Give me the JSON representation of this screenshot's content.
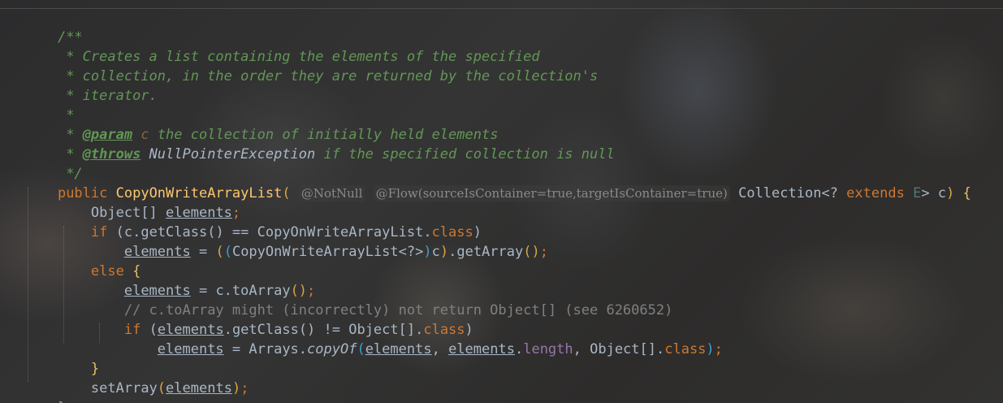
{
  "editor": {
    "code": {
      "javadoc_open": "/**",
      "doc_line_1": " * Creates a list containing the elements of the specified",
      "doc_line_2": " * collection, in the order they are returned by the collection's",
      "doc_line_3": " * iterator.",
      "doc_line_4": " *",
      "param_prefix": " * ",
      "param_tag": "@param",
      "param_name": " c",
      "param_desc": " the collection of initially held elements",
      "throws_prefix": " * ",
      "throws_tag": "@throws",
      "throws_ref": " NullPointerException",
      "throws_desc": " if the specified collection is null",
      "javadoc_close": " */",
      "sig_public": "public",
      "sig_name": "CopyOnWriteArrayList",
      "sig_paren_open": "(",
      "hint_notnull": "@NotNull",
      "hint_flow": "@Flow(sourceIsContainer=true,targetIsContainer=true)",
      "sig_type": "Collection<? ",
      "sig_extends": "extends",
      "sig_generic": "E",
      "sig_param": "> c",
      "sig_paren_close": ")",
      "sig_brace_open": "{",
      "decl_type": "Object[] ",
      "decl_var": "elements",
      "decl_semi": ";",
      "if1_kw": "if",
      "if1_cond_start": " (c.getClass() == CopyOnWriteArrayList.",
      "if1_class_kw": "class",
      "if1_close": ")",
      "assign1_var": "elements",
      "assign1_mid": " = ",
      "assign1_paren_a": "(",
      "assign1_paren_b": "(",
      "assign1_cast": "CopyOnWriteArrayList<?>",
      "assign1_paren_c": ")",
      "assign1_c": "c",
      "assign1_paren_d": ")",
      "assign1_call": ".getArray",
      "assign1_call_parens": "()",
      "assign1_semi": ";",
      "else_kw": "else",
      "else_brace": "{",
      "assign2_var": "elements",
      "assign2_rest": " = c.toArray",
      "assign2_parens": "()",
      "assign2_semi": ";",
      "comment_line": "// c.toArray might (incorrectly) not return Object[] (see 6260652)",
      "if2_kw": "if",
      "if2_open": " (",
      "if2_var": "elements",
      "if2_rest": ".getClass() != Object[].",
      "if2_class_kw": "class",
      "if2_close": ")",
      "assign3_var": "elements",
      "assign3_mid": " = Arrays.",
      "assign3_call": "copyOf",
      "assign3_paren_open": "(",
      "assign3_arg1": "elements",
      "assign3_comma1": ", ",
      "assign3_arg2": "elements",
      "assign3_dot": ".",
      "assign3_length": "length",
      "assign3_comma2": ", Object[].",
      "assign3_class_kw": "class",
      "assign3_paren_close": ")",
      "assign3_semi": ";",
      "else_close": "}",
      "set_call": "setArray",
      "set_paren_open": "(",
      "set_arg": "elements",
      "set_paren_close": ")",
      "set_semi": ";",
      "ctor_close": "}"
    }
  }
}
